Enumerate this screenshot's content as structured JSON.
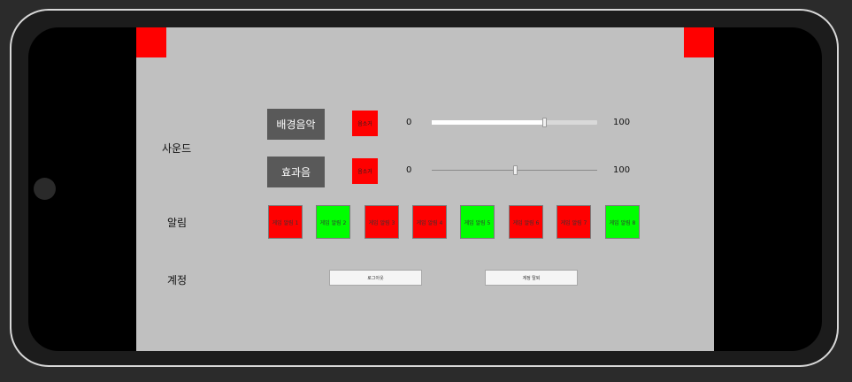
{
  "sound": {
    "label": "사운드",
    "bgm": {
      "label": "배경음악",
      "toggle_label": "음소거",
      "min": "0",
      "max": "100",
      "value": 0.68
    },
    "sfx": {
      "label": "효과음",
      "toggle_label": "음소거",
      "min": "0",
      "max": "100",
      "value": 0.5
    }
  },
  "alarm": {
    "label": "알림",
    "items": [
      {
        "label": "게임 알림 1",
        "color": "#ff0000"
      },
      {
        "label": "게임 알림 2",
        "color": "#00ff00"
      },
      {
        "label": "게임 알림 3",
        "color": "#ff0000"
      },
      {
        "label": "게임 알림 4",
        "color": "#ff0000"
      },
      {
        "label": "게임 알림 5",
        "color": "#00ff00"
      },
      {
        "label": "게임 알림 6",
        "color": "#ff0000"
      },
      {
        "label": "게임 알림 7",
        "color": "#ff0000"
      },
      {
        "label": "게임 알림 8",
        "color": "#00ff00"
      }
    ]
  },
  "account": {
    "label": "계정",
    "logout_label": "로그아웃",
    "delete_label": "계정 탈퇴"
  }
}
